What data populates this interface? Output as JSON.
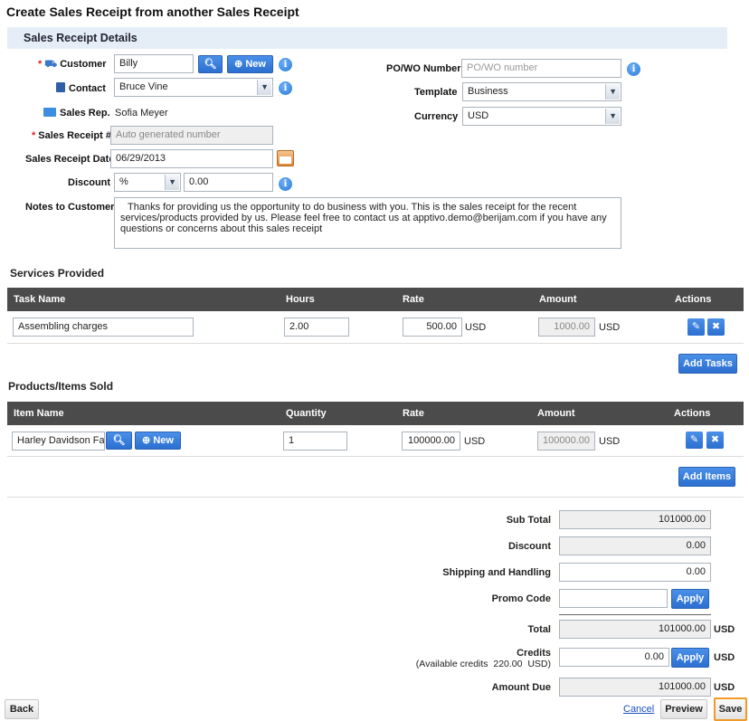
{
  "page": {
    "title": "Create Sales Receipt from another Sales Receipt"
  },
  "details": {
    "section_title": "Sales Receipt Details",
    "customer_label": "Customer",
    "customer_value": "Billy",
    "new_label": "New",
    "contact_label": "Contact",
    "contact_value": "Bruce Vine",
    "sales_rep_label": "Sales Rep.",
    "sales_rep_value": "Sofia Meyer",
    "receipt_no_label": "Sales Receipt #",
    "receipt_no_placeholder": "Auto generated number",
    "date_label": "Sales Receipt Date",
    "date_value": "06/29/2013",
    "discount_label": "Discount",
    "discount_type": "%",
    "discount_value": "0.00",
    "notes_label": "Notes to Customer",
    "notes_value": "Thanks for providing us the opportunity to do business with you. This is the sales receipt for the recent services/products provided by us. Please feel free to contact us at apptivo.demo@berijam.com if you have any questions or concerns about this sales receipt",
    "po_label": "PO/WO Number",
    "po_placeholder": "PO/WO number",
    "template_label": "Template",
    "template_value": "Business",
    "currency_label": "Currency",
    "currency_value": "USD"
  },
  "services": {
    "title": "Services Provided",
    "columns": [
      "Task Name",
      "Hours",
      "Rate",
      "Amount",
      "Actions"
    ],
    "row": {
      "task": "Assembling charges",
      "hours": "2.00",
      "rate": "500.00",
      "amount": "1000.00",
      "currency": "USD"
    },
    "add_label": "Add Tasks"
  },
  "products": {
    "title": "Products/Items Sold",
    "columns": [
      "Item Name",
      "Quantity",
      "Rate",
      "Amount",
      "Actions"
    ],
    "row": {
      "item": "Harley Davidson Fatbo",
      "quantity": "1",
      "rate": "100000.00",
      "amount": "100000.00",
      "currency": "USD"
    },
    "new_label": "New",
    "add_label": "Add Items"
  },
  "totals": {
    "sub_total_label": "Sub Total",
    "sub_total": "101000.00",
    "discount_label": "Discount",
    "discount": "0.00",
    "shipping_label": "Shipping and Handling",
    "shipping": "0.00",
    "promo_label": "Promo Code",
    "promo_value": "",
    "apply_label": "Apply",
    "total_label": "Total",
    "total": "101000.00",
    "credits_label": "Credits",
    "credits_note": "(Available credits  220.00  USD)",
    "credits": "0.00",
    "amount_due_label": "Amount Due",
    "amount_due": "101000.00",
    "currency": "USD"
  },
  "footer": {
    "back_label": "Back",
    "cancel_label": "Cancel",
    "preview_label": "Preview",
    "save_label": "Save"
  }
}
